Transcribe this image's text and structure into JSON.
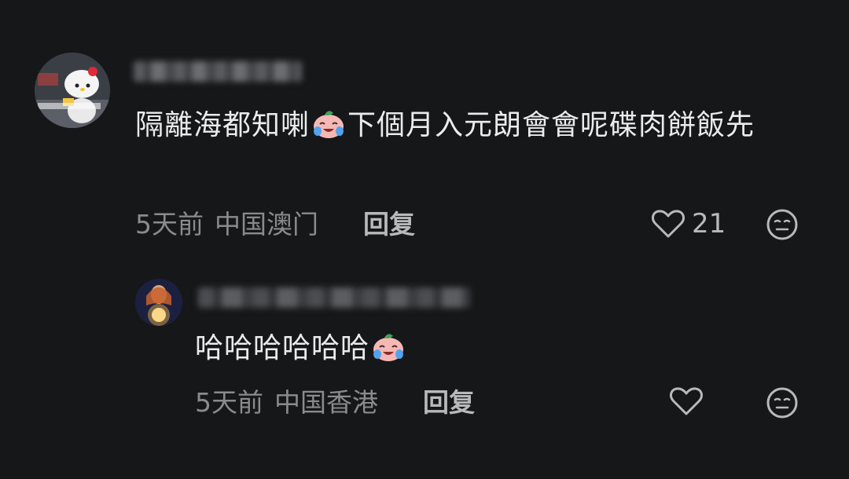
{
  "comments": [
    {
      "text_before_emoji": "隔離海都知喇",
      "emoji_icon": "crying-laughing-peach-emoji",
      "text_after_emoji": "下個月入元朗會會呢碟肉餅飯先",
      "time": "5天前",
      "location": "中国澳门",
      "reply_label": "回复",
      "likes": "21",
      "reaction_icon": "neutral-face-icon",
      "avatar_icon": "hello-kitty-avatar"
    },
    {
      "text_before_emoji": "哈哈哈哈哈哈",
      "emoji_icon": "crying-laughing-peach-emoji",
      "time": "5天前",
      "location": "中国香港",
      "reply_label": "回复",
      "likes": "",
      "reaction_icon": "neutral-face-icon",
      "avatar_icon": "glowing-orb-avatar"
    }
  ],
  "colors": {
    "background": "#161719",
    "text": "#ebebeb",
    "meta": "#8a8b8f",
    "icon": "#b8b9bc"
  }
}
